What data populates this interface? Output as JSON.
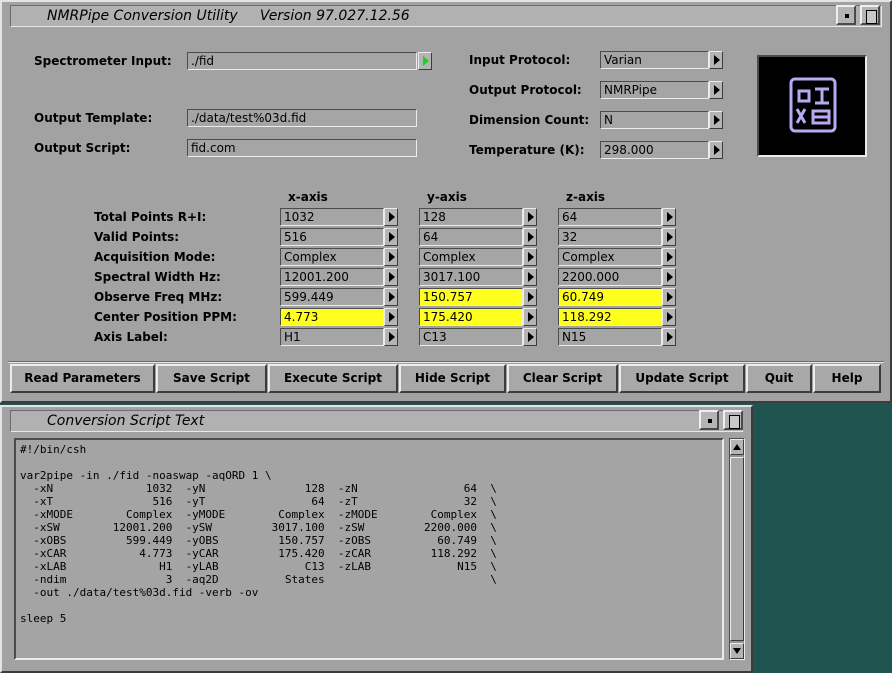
{
  "main_window": {
    "title": "NMRPipe Conversion Utility     Version 97.027.12.56"
  },
  "script_window": {
    "title": "Conversion Script Text"
  },
  "form": {
    "spectrometer_input_label": "Spectrometer Input:",
    "spectrometer_input_value": "./fid",
    "output_template_label": "Output Template:",
    "output_template_value": "./data/test%03d.fid",
    "output_script_label": "Output Script:",
    "output_script_value": "fid.com",
    "input_protocol_label": "Input Protocol:",
    "input_protocol_value": "Varian",
    "output_protocol_label": "Output Protocol:",
    "output_protocol_value": "NMRPipe",
    "dimension_count_label": "Dimension Count:",
    "dimension_count_value": "N",
    "temperature_label": "Temperature (K):",
    "temperature_value": "298.000"
  },
  "axes": {
    "headers": [
      "x-axis",
      "y-axis",
      "z-axis"
    ],
    "rows": [
      {
        "label": "Total Points R+I:",
        "values": [
          "1032",
          "128",
          "64"
        ],
        "highlight": [
          false,
          false,
          false
        ]
      },
      {
        "label": "Valid Points:",
        "values": [
          "516",
          "64",
          "32"
        ],
        "highlight": [
          false,
          false,
          false
        ]
      },
      {
        "label": "Acquisition Mode:",
        "values": [
          "Complex",
          "Complex",
          "Complex"
        ],
        "highlight": [
          false,
          false,
          false
        ]
      },
      {
        "label": "Spectral Width Hz:",
        "values": [
          "12001.200",
          "3017.100",
          "2200.000"
        ],
        "highlight": [
          false,
          false,
          false
        ]
      },
      {
        "label": "Observe Freq MHz:",
        "values": [
          "599.449",
          "150.757",
          "60.749"
        ],
        "highlight": [
          false,
          true,
          true
        ]
      },
      {
        "label": "Center Position PPM:",
        "values": [
          "4.773",
          "175.420",
          "118.292"
        ],
        "highlight": [
          true,
          true,
          true
        ]
      },
      {
        "label": "Axis Label:",
        "values": [
          "H1",
          "C13",
          "N15"
        ],
        "highlight": [
          false,
          false,
          false
        ]
      }
    ]
  },
  "buttons": [
    "Read Parameters",
    "Save Script",
    "Execute Script",
    "Hide Script",
    "Clear Script",
    "Update Script",
    "Quit",
    "Help"
  ],
  "script_text": "#!/bin/csh\n\nvar2pipe -in ./fid -noaswap -aqORD 1 \\\n  -xN              1032  -yN               128  -zN                64  \\\n  -xT               516  -yT                64  -zT                32  \\\n  -xMODE        Complex  -yMODE        Complex  -zMODE        Complex  \\\n  -xSW        12001.200  -ySW         3017.100  -zSW         2200.000  \\\n  -xOBS         599.449  -yOBS         150.757  -zOBS          60.749  \\\n  -xCAR           4.773  -yCAR         175.420  -zCAR         118.292  \\\n  -xLAB              H1  -yLAB             C13  -zLAB             N15  \\\n  -ndim               3  -aq2D          States                         \\\n  -out ./data/test%03d.fid -verb -ov\n\nsleep 5",
  "colors": {
    "highlight": "#ffff1e",
    "desktop": "#1f5450",
    "panel": "#a2a2a2",
    "logo_glyph": "#b9a8f2"
  },
  "icons": {
    "logo": "nmrpipe-seal-logo",
    "dropdown": "triangle-right-icon",
    "input_arrow": "green-triangle-right-icon"
  }
}
